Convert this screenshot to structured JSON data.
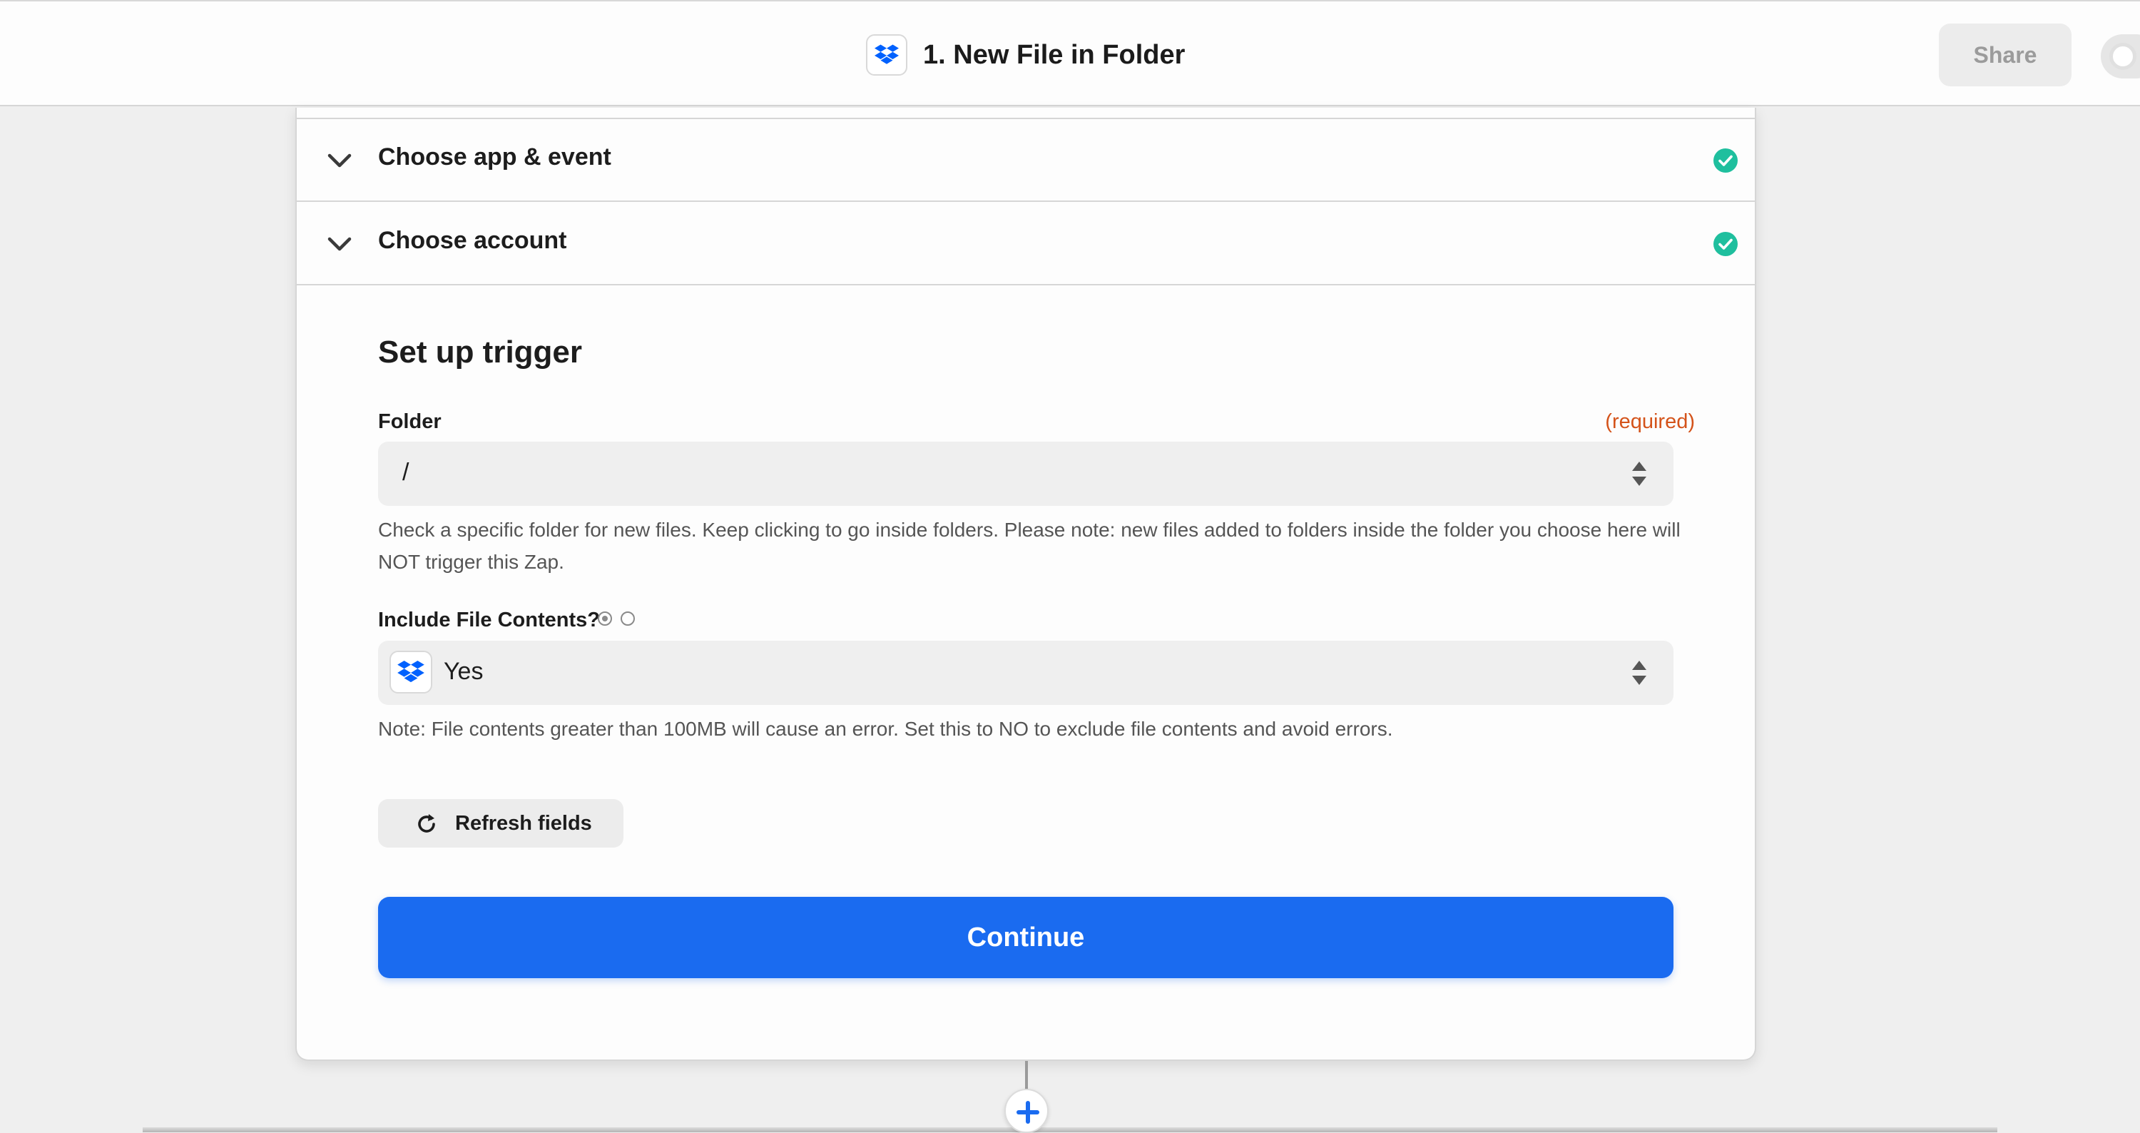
{
  "header": {
    "step_title": "1. New File in Folder",
    "app_icon": "dropbox-icon",
    "share_label": "Share"
  },
  "sections": [
    {
      "label": "Choose app & event",
      "status": "complete"
    },
    {
      "label": "Choose account",
      "status": "complete"
    }
  ],
  "setup": {
    "title": "Set up trigger",
    "folder": {
      "label": "Folder",
      "required_label": "(required)",
      "value": "/",
      "help": "Check a specific folder for new files. Keep clicking to go inside folders. Please note: new files added to folders inside the folder you choose here will NOT trigger this Zap."
    },
    "include_contents": {
      "label": "Include File Contents?",
      "value": "Yes",
      "help": "Note: File contents greater than 100MB will cause an error. Set this to NO to exclude file contents and avoid errors."
    },
    "refresh_label": "Refresh fields",
    "continue_label": "Continue"
  },
  "colors": {
    "accent": "#1a6bf0",
    "success": "#1fbf9e",
    "required": "#d4531a",
    "dropbox": "#0061fe"
  }
}
